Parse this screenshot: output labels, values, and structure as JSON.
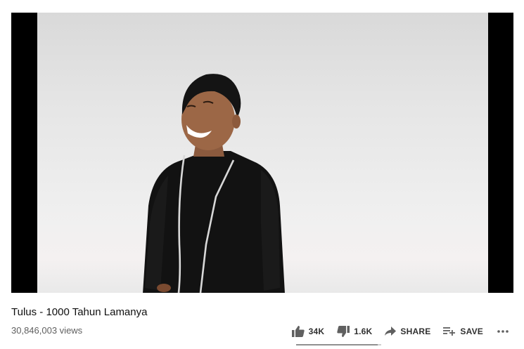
{
  "video": {
    "title": "Tulus - 1000 Tahun Lamanya",
    "views": "30,846,003 views"
  },
  "actions": {
    "like_count": "34K",
    "dislike_count": "1.6K",
    "share_label": "SHARE",
    "save_label": "SAVE"
  },
  "icons": {
    "like": "thumb-up-icon",
    "dislike": "thumb-down-icon",
    "share": "share-arrow-icon",
    "save": "playlist-add-icon",
    "more": "more-horizontal-icon"
  },
  "sentiment_bar": {
    "like_fraction": 0.955
  }
}
